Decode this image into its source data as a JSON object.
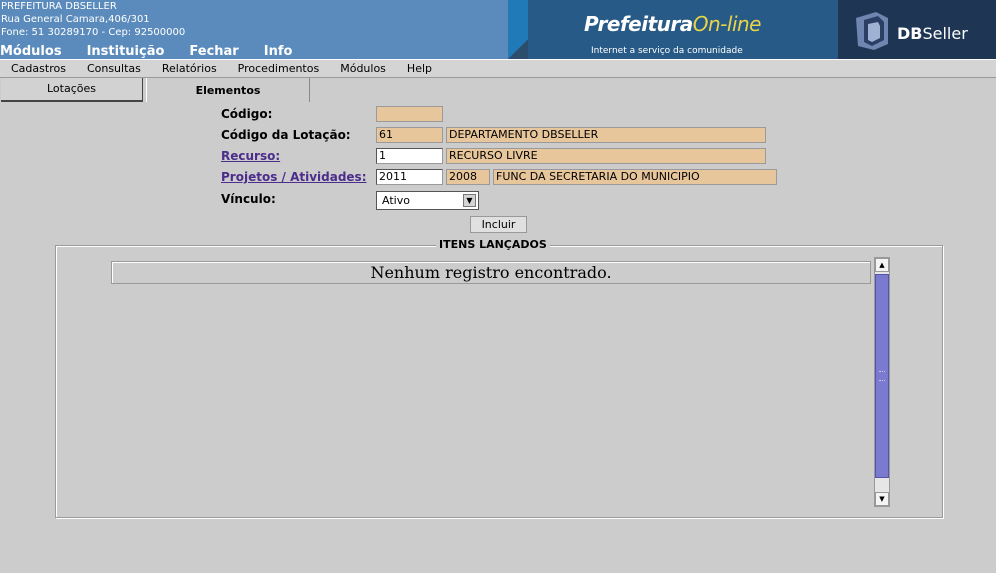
{
  "header": {
    "org_name": "PREFEITURA DBSELLER",
    "address": "Rua General Camara,406/301",
    "phone_line": "Fone: 51 30289170  -  Cep: 92500000",
    "top_menu": [
      "Módulos",
      "Instituição",
      "Fechar",
      "Info"
    ],
    "banner": {
      "logo_main": "Prefeitura",
      "logo_accent": "On-line",
      "tagline": "Internet a serviço da comunidade",
      "brand_bold": "DB",
      "brand_rest": "Seller"
    }
  },
  "menubar": [
    "Cadastros",
    "Consultas",
    "Relatórios",
    "Procedimentos",
    "Módulos",
    "Help"
  ],
  "tabs": [
    {
      "label": "Lotações",
      "active": false
    },
    {
      "label": "Elementos",
      "active": true
    }
  ],
  "form": {
    "codigo_label": "Código:",
    "codigo_value": "",
    "lotacao_label": "Código da Lotação:",
    "lotacao_code": "61",
    "lotacao_desc": "DEPARTAMENTO DBSELLER",
    "recurso_label": "Recurso:",
    "recurso_code": "1",
    "recurso_desc": "RECURSO LIVRE",
    "projetos_label": "Projetos / Atividades:",
    "projetos_year": "2011",
    "projetos_code": "2008",
    "projetos_desc": "FUNC DA SECRETARIA DO MUNICIPIO",
    "vinculo_label": "Vínculo:",
    "vinculo_selected": "Ativo",
    "incluir_label": "Incluir"
  },
  "items": {
    "legend": "ITENS LANÇADOS",
    "empty_message": "Nenhum registro encontrado."
  },
  "colors": {
    "header_bg": "#5b8bbc",
    "readonly_field": "#e8c69c",
    "link": "#4b2d8c",
    "scroll_thumb": "#7a7ad0"
  }
}
